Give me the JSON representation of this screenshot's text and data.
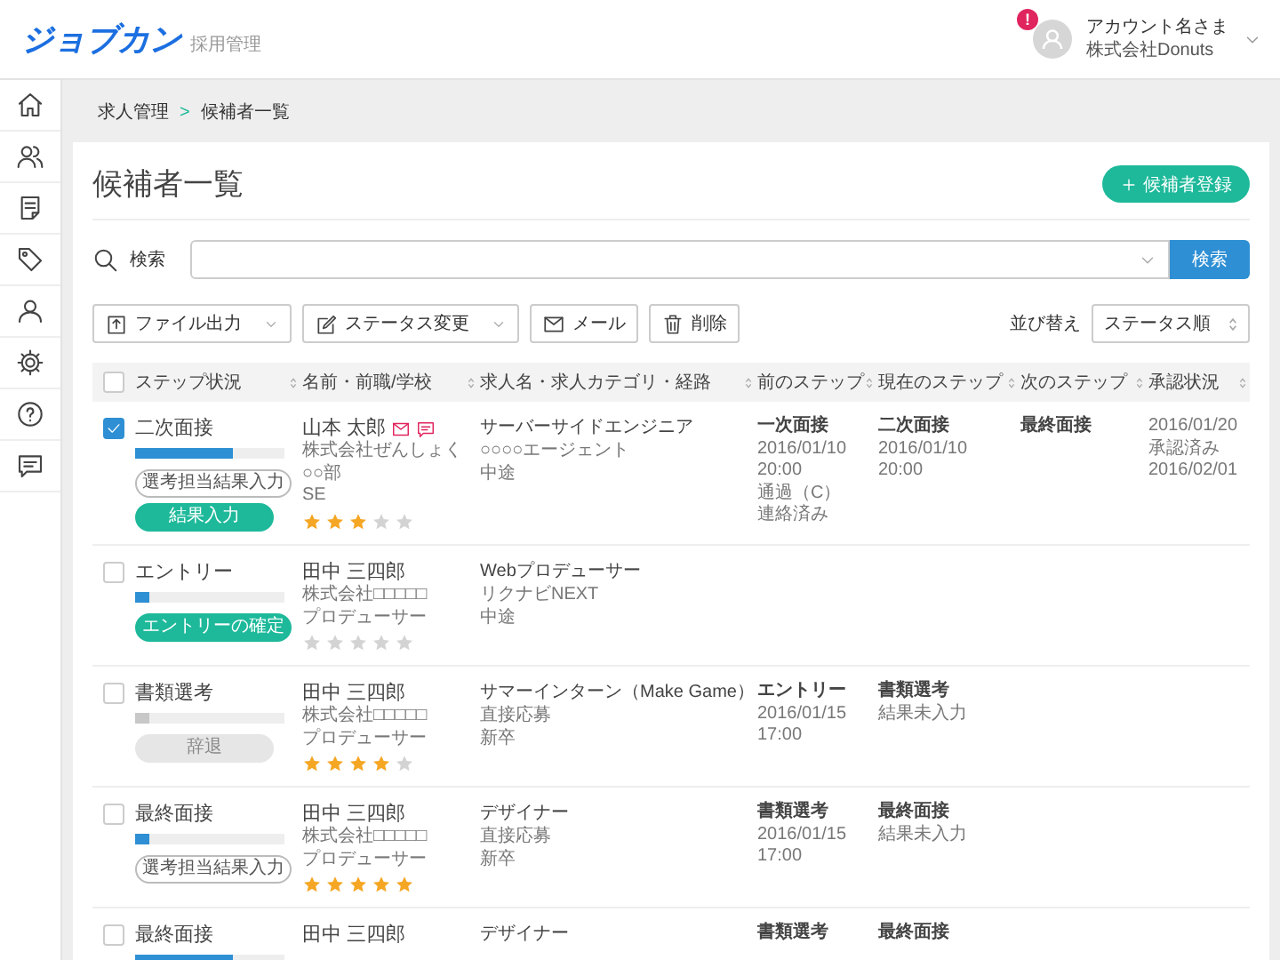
{
  "app": {
    "logo": "ジョブカン",
    "subtitle": "採用管理"
  },
  "account": {
    "alert": "!",
    "name": "アカウント名さま",
    "company": "株式会社Donuts"
  },
  "breadcrumb": {
    "items": [
      "求人管理",
      "候補者一覧"
    ],
    "separator": ">"
  },
  "page_title": "候補者一覧",
  "add_button": "候補者登録",
  "search": {
    "label": "検索",
    "button": "検索"
  },
  "toolbar": {
    "actions": [
      {
        "label": "ファイル出力",
        "kind": "export"
      },
      {
        "label": "ステータス変更",
        "kind": "status"
      },
      {
        "label": "メール",
        "kind": "mail"
      },
      {
        "label": "削除",
        "kind": "delete"
      }
    ]
  },
  "sort": {
    "label": "並び替え",
    "value": "ステータス順"
  },
  "table": {
    "select_all": {
      "checked": false
    },
    "columns": [
      "ステップ状況",
      "名前・前職/学校",
      "求人名・求人カテゴリ・経路",
      "前のステップ",
      "現在のステップ",
      "次のステップ",
      "承認状況"
    ],
    "rows": [
      {
        "checked": true,
        "step": "二次面接",
        "level": 0.65,
        "inactive": false,
        "actions": [
          {
            "label": "選考担当結果入力",
            "kind": "outline"
          },
          {
            "label": "結果入力",
            "kind": "primary"
          }
        ],
        "name": "山本 太郎",
        "mail": true,
        "message": true,
        "profile": [
          "株式会社ぜんしょく",
          "○○部",
          "SE"
        ],
        "stars": 3,
        "job": "サーバーサイドエンジニア",
        "job_details": [
          "○○○○エージェント",
          "中途"
        ],
        "prev_step": {
          "title": "一次面接",
          "lines": [
            "2016/01/10",
            "20:00",
            "通過（C）",
            "連絡済み"
          ]
        },
        "current_step": {
          "title": "二次面接",
          "lines": [
            "2016/01/10",
            "20:00"
          ]
        },
        "next_step": {
          "title": "最終面接"
        },
        "approval": [
          "2016/01/20",
          "承認済み",
          "2016/02/01"
        ]
      },
      {
        "checked": false,
        "step": "エントリー",
        "level": 0.1,
        "inactive": false,
        "actions": [
          {
            "label": "エントリーの確定",
            "kind": "primary"
          }
        ],
        "name": "田中 三四郎",
        "mail": false,
        "message": false,
        "profile": [
          "株式会社□□□□□",
          "プロデューサー"
        ],
        "stars": 0,
        "job": "Webプロデューサー",
        "job_details": [
          "リクナビNEXT",
          "中途"
        ]
      },
      {
        "checked": false,
        "step": "書類選考",
        "level": 0.1,
        "inactive": true,
        "actions": [
          {
            "label": "辞退",
            "kind": "disabled"
          }
        ],
        "name": "田中 三四郎",
        "mail": false,
        "message": false,
        "profile": [
          "株式会社□□□□□",
          "プロデューサー"
        ],
        "stars": 4,
        "job": "サマーインターン（Make Game）",
        "job_details": [
          "直接応募",
          "新卒"
        ],
        "prev_step": {
          "title": "エントリー",
          "lines": [
            "2016/01/15",
            "17:00"
          ]
        },
        "current_step": {
          "title": "書類選考",
          "lines": [
            "結果未入力"
          ]
        }
      },
      {
        "checked": false,
        "step": "最終面接",
        "level": 0.1,
        "inactive": false,
        "actions": [
          {
            "label": "選考担当結果入力",
            "kind": "outline"
          }
        ],
        "name": "田中 三四郎",
        "mail": false,
        "message": false,
        "profile": [
          "株式会社□□□□□",
          "プロデューサー"
        ],
        "stars": 5,
        "job": "デザイナー",
        "job_details": [
          "直接応募",
          "新卒"
        ],
        "prev_step": {
          "title": "書類選考",
          "lines": [
            "2016/01/15",
            "17:00"
          ]
        },
        "current_step": {
          "title": "最終面接",
          "lines": [
            "結果未入力"
          ]
        }
      },
      {
        "checked": false,
        "step": "最終面接",
        "level": 0.65,
        "inactive": false,
        "name": "田中 三四郎",
        "mail": false,
        "message": false,
        "job": "デザイナー",
        "prev_step": {
          "title": "書類選考"
        },
        "current_step": {
          "title": "最終面接"
        }
      }
    ]
  }
}
